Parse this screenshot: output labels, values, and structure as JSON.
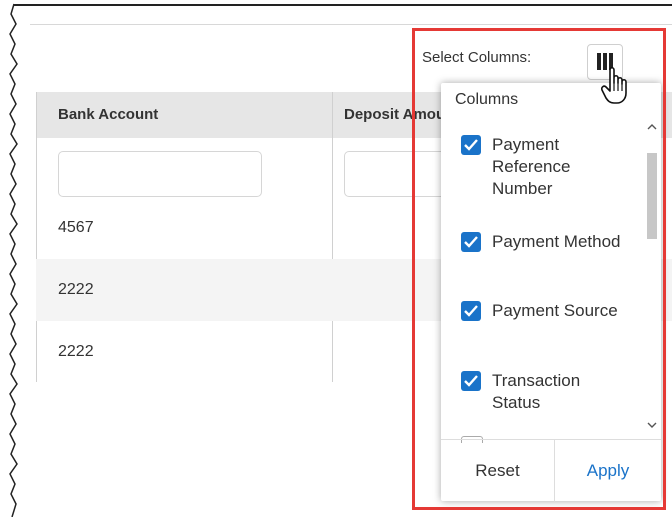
{
  "toolbar": {
    "select_columns_label": "Select Columns:",
    "columns_button_icon": "columns-icon"
  },
  "table": {
    "headers": [
      "Bank Account",
      "Deposit Amount"
    ],
    "rows": [
      {
        "bank_account": "4567"
      },
      {
        "bank_account": "2222"
      },
      {
        "bank_account": "2222"
      }
    ]
  },
  "columns_popup": {
    "title": "Columns",
    "options": [
      {
        "label": "Payment Reference Number",
        "checked": true
      },
      {
        "label": "Payment Method",
        "checked": true
      },
      {
        "label": "Payment Source",
        "checked": true
      },
      {
        "label": "Transaction Status",
        "checked": true
      }
    ],
    "reset_label": "Reset",
    "apply_label": "Apply"
  },
  "colors": {
    "accent": "#1a73c9",
    "highlight": "#e53935",
    "header_bg": "#e6e6e6"
  }
}
